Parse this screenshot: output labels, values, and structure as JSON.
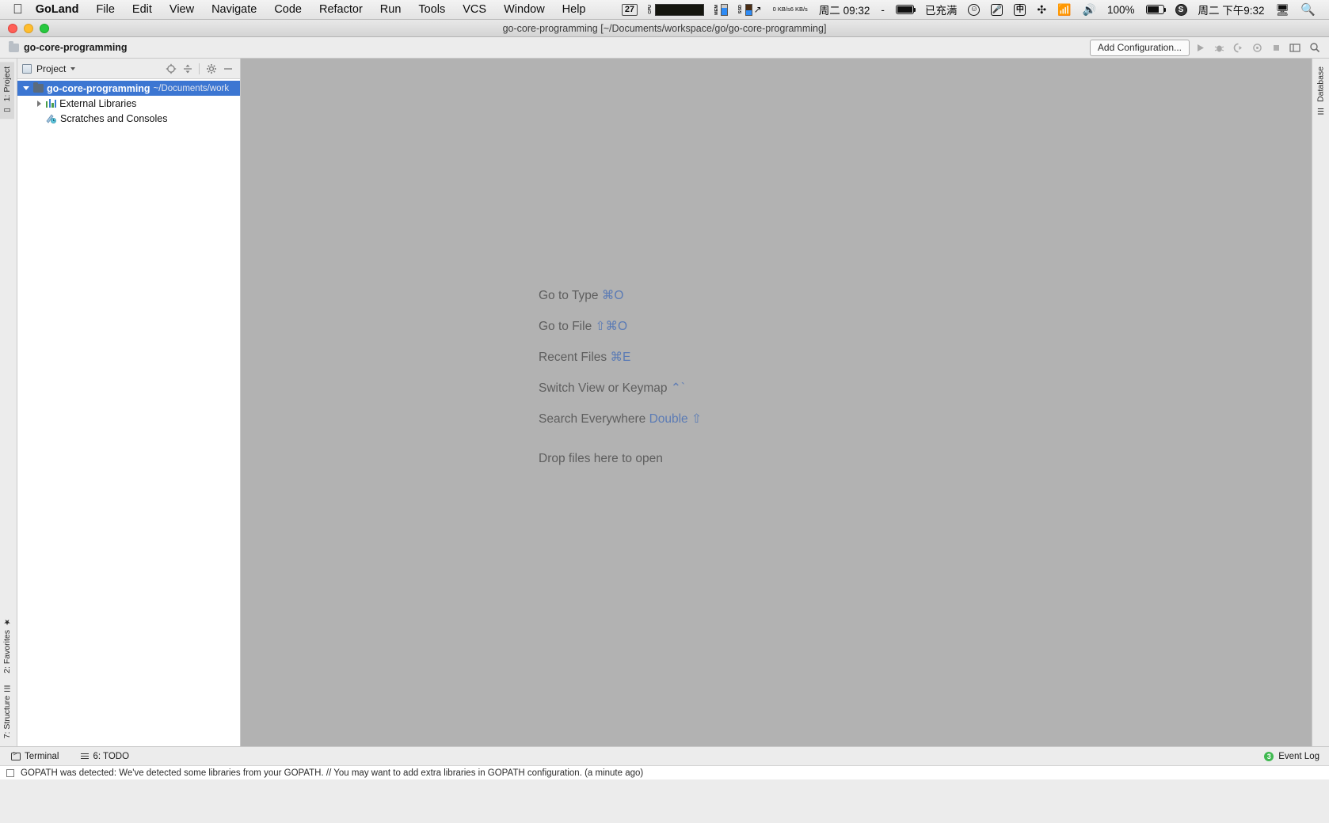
{
  "macos_menubar": {
    "apple_icon": "apple-icon",
    "items": [
      {
        "label": "GoLand",
        "bold": true
      },
      {
        "label": "File",
        "bold": false
      },
      {
        "label": "Edit",
        "bold": false
      },
      {
        "label": "View",
        "bold": false
      },
      {
        "label": "Navigate",
        "bold": false
      },
      {
        "label": "Code",
        "bold": false
      },
      {
        "label": "Refactor",
        "bold": false
      },
      {
        "label": "Run",
        "bold": false
      },
      {
        "label": "Tools",
        "bold": false
      },
      {
        "label": "VCS",
        "bold": false
      },
      {
        "label": "Window",
        "bold": false
      },
      {
        "label": "Help",
        "bold": false
      }
    ],
    "status": {
      "day_counter": "27",
      "cpu_label": "CPU",
      "mem_label": "MEM",
      "ssd_label": "SSD",
      "net_up": "0 KB/s",
      "net_down": "6 KB/s",
      "date_time_left": "周二 09:32",
      "dash": "-",
      "battery_text": "已充满",
      "input_method": "中",
      "volume_percent": "100%",
      "clock_right": "周二 下午9:32"
    }
  },
  "window": {
    "title": "go-core-programming [~/Documents/workspace/go/go-core-programming]",
    "traffic_lights": [
      "close-button",
      "minimize-button",
      "zoom-button"
    ]
  },
  "navbar": {
    "breadcrumb": "go-core-programming",
    "add_configuration": "Add Configuration...",
    "toolbar_icons": [
      "run-icon",
      "debug-icon",
      "run-with-coverage-icon",
      "profile-icon",
      "stop-icon",
      "select-opened-file-icon",
      "search-everywhere-icon"
    ]
  },
  "left_rail": {
    "top": [
      {
        "label": "1: Project",
        "icon": "project-icon",
        "selected": true
      }
    ],
    "bottom": [
      {
        "label": "2: Favorites",
        "icon": "star-icon",
        "selected": false
      },
      {
        "label": "7: Structure",
        "icon": "structure-icon",
        "selected": false
      }
    ]
  },
  "right_rail": {
    "items": [
      {
        "label": "Database",
        "icon": "database-icon"
      }
    ]
  },
  "project_panel": {
    "title": "Project",
    "tools": [
      "locate-icon",
      "collapse-all-icon",
      "settings-gear-icon",
      "hide-icon"
    ],
    "tree": [
      {
        "label": "go-core-programming",
        "path": "~/Documents/work",
        "icon": "folder-icon",
        "state": "expanded",
        "selected": true,
        "indent": 0
      },
      {
        "label": "External Libraries",
        "path": "",
        "icon": "libraries-icon",
        "state": "collapsed",
        "selected": false,
        "indent": 1
      },
      {
        "label": "Scratches and Consoles",
        "path": "",
        "icon": "scratches-icon",
        "state": "leaf",
        "selected": false,
        "indent": 1
      }
    ]
  },
  "editor_placeholder": {
    "tips": [
      {
        "text": "Go to Type ",
        "shortcut": "⌘O"
      },
      {
        "text": "Go to File ",
        "shortcut": "⇧⌘O"
      },
      {
        "text": "Recent Files ",
        "shortcut": "⌘E"
      },
      {
        "text": "Switch View or Keymap ",
        "shortcut": "⌃`"
      },
      {
        "text": "Search Everywhere ",
        "shortcut": "Double ⇧"
      }
    ],
    "drop_hint": "Drop files here to open"
  },
  "bottom_bar": {
    "items": [
      {
        "label": "Terminal",
        "icon": "terminal-icon"
      },
      {
        "label": "6: TODO",
        "icon": "todo-icon"
      }
    ],
    "event_log": {
      "label": "Event Log",
      "badge": "3"
    }
  },
  "notification": {
    "text": "GOPATH was detected: We've detected some libraries from your GOPATH. // You may want to add extra libraries in GOPATH configuration. (a minute ago)"
  },
  "colors": {
    "selection_blue": "#3c76d2",
    "editor_bg": "#b2b2b2",
    "chrome_bg": "#ececec",
    "shortcut_blue": "#5b7bb5",
    "event_green": "#3fb950"
  }
}
